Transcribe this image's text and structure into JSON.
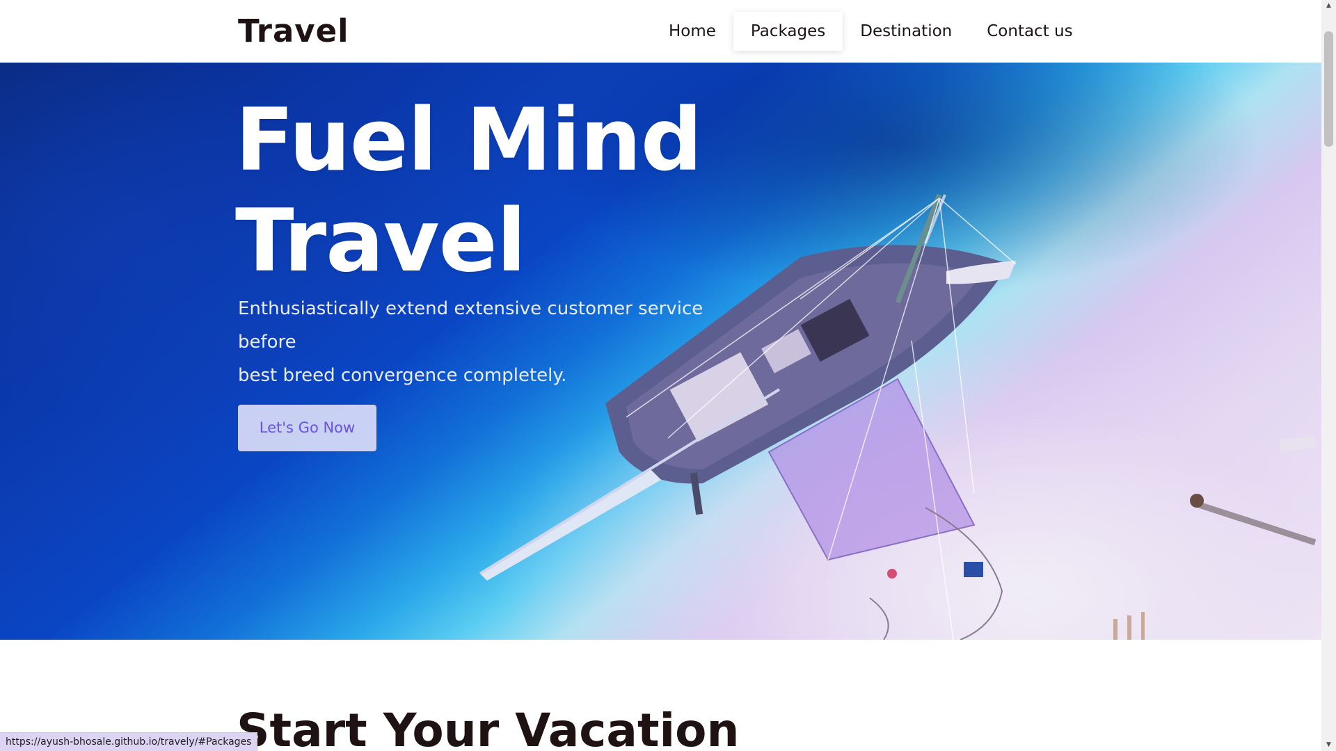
{
  "header": {
    "logo": "Travel",
    "nav": [
      {
        "label": "Home"
      },
      {
        "label": "Packages",
        "active": true
      },
      {
        "label": "Destination"
      },
      {
        "label": "Contact us"
      }
    ]
  },
  "hero": {
    "title_line1": "Fuel Mind",
    "title_line2": "Travel",
    "subtitle_line1": "Enthusiastically extend extensive customer service before",
    "subtitle_line2": "best breed convergence completely.",
    "cta_label": "Let's Go Now",
    "image": "aerial-boat-on-beach"
  },
  "section": {
    "title": "Start Your Vacation"
  },
  "status_bar": {
    "url": "https://ayush-bhosale.github.io/travely/#Packages"
  },
  "colors": {
    "text_dark": "#1f1213",
    "cta_text": "#6a52e6",
    "cta_bg": "#dee0f8",
    "ocean_deep": "#0a36a8",
    "sand": "#e2d6f2"
  }
}
